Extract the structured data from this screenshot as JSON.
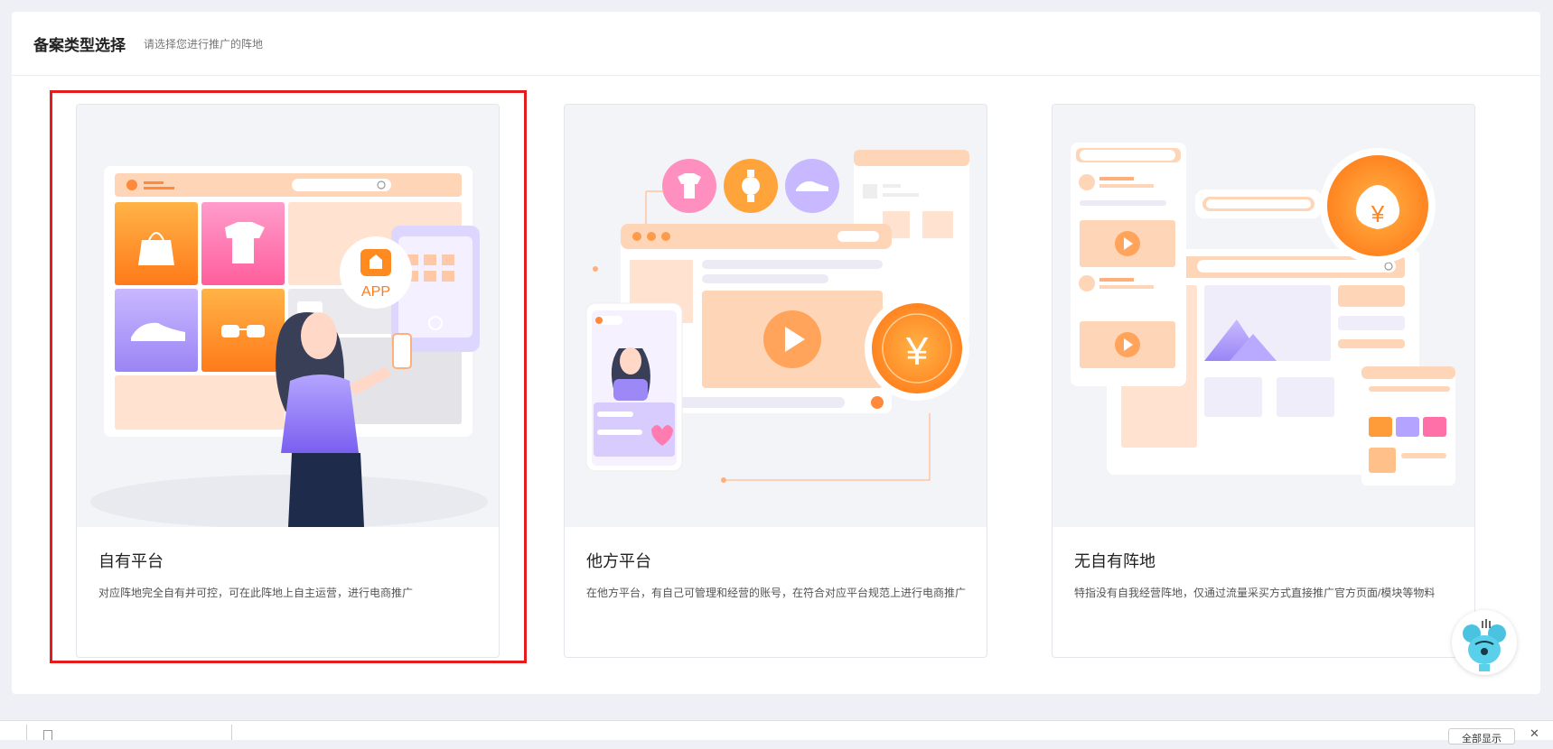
{
  "header": {
    "title": "备案类型选择",
    "subtitle": "请选择您进行推广的阵地"
  },
  "cards": [
    {
      "title": "自有平台",
      "description": "对应阵地完全自有并可控，可在此阵地上自主运营，进行电商推广",
      "selected": true,
      "app_badge": "APP"
    },
    {
      "title": "他方平台",
      "description": "在他方平台，有自己可管理和经营的账号，在符合对应平台规范上进行电商推广",
      "selected": false,
      "coin_symbol": "¥"
    },
    {
      "title": "无自有阵地",
      "description": "特指没有自我经营阵地，仅通过流量采买方式直接推广官方页面/模块等物料",
      "selected": false,
      "coin_symbol": "¥"
    }
  ],
  "bottom_bar": {
    "show_all_label": "全部显示",
    "close_glyph": "✕"
  },
  "colors": {
    "selected_border": "#e41c1c",
    "accent_orange": "#ff8a1f",
    "accent_purple": "#8e7cf5",
    "accent_pink": "#ff6fa8"
  },
  "icons": [
    "bag-icon",
    "tshirt-icon",
    "shoe-icon",
    "glasses-icon",
    "play-icon",
    "yuan-coin-icon",
    "search-icon",
    "assistant-mascot-icon",
    "file-icon",
    "close-icon"
  ]
}
